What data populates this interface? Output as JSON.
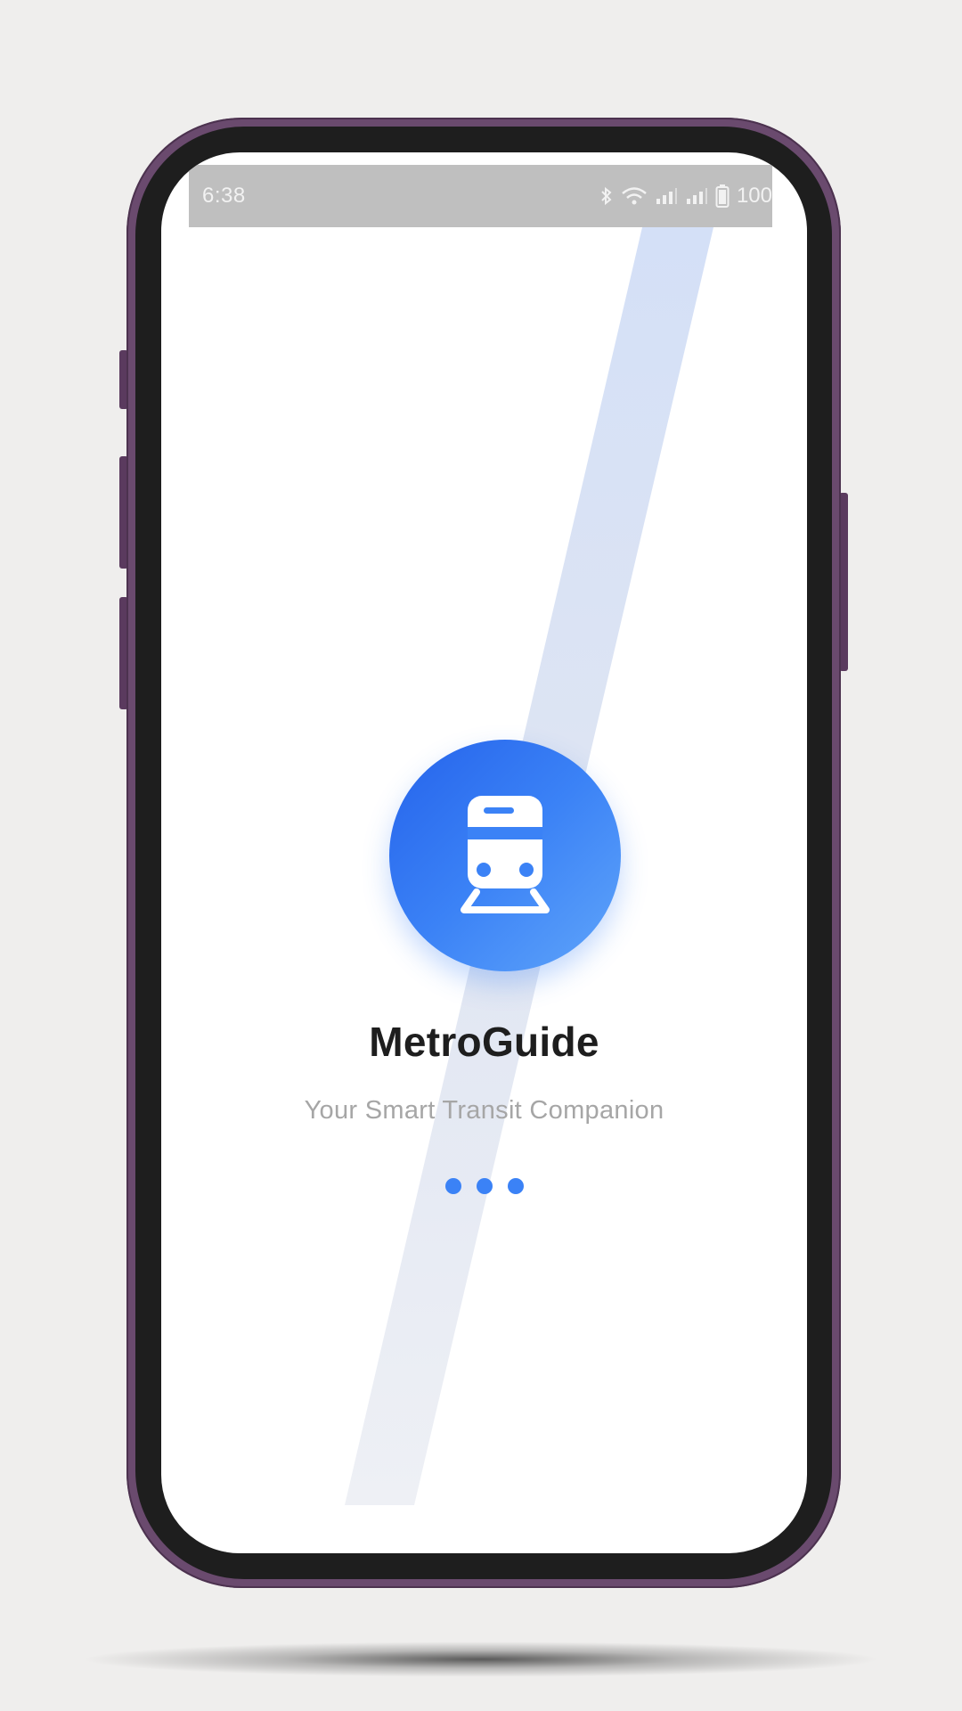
{
  "status_bar": {
    "time": "6:38",
    "battery_text": "100",
    "icons": [
      "bluetooth-icon",
      "wifi-icon",
      "signal-icon",
      "signal-icon",
      "battery-icon"
    ]
  },
  "splash": {
    "app_name": "MetroGuide",
    "tagline": "Your Smart Transit Companion",
    "logo_icon": "train-icon",
    "loader_dots": 3
  },
  "colors": {
    "accent": "#3b82f6",
    "accent_dark": "#2563eb",
    "accent_light": "#60a5fa",
    "title": "#1e1e1e",
    "subtitle": "#a6a6a6",
    "status_bar_bg": "#bfbfbf",
    "device_frame": "#6a4a6e",
    "bezel": "#1e1e1e",
    "background": "#efeeed"
  }
}
